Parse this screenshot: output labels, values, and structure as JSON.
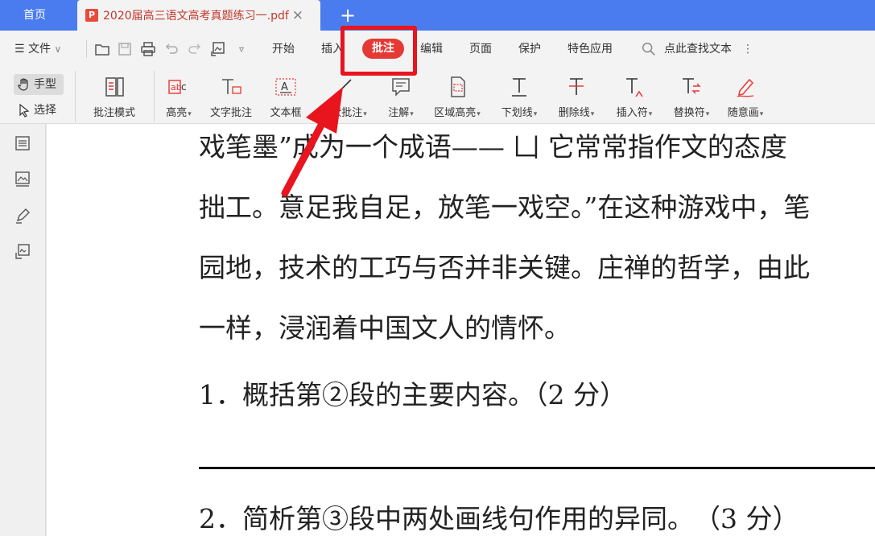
{
  "tabs": {
    "home": "首页",
    "doc_title": "2020届高三语文高考真题练习一.pdf",
    "doc_icon": "pdf-icon",
    "close_icon": "close-icon",
    "add_icon": "plus-icon"
  },
  "menu": {
    "hamburger_icon": "menu-icon",
    "file": "文件",
    "items": [
      "开始",
      "插入",
      "批注",
      "编辑",
      "页面",
      "保护",
      "特色应用"
    ],
    "active": "批注",
    "search_placeholder": "点此查找文本",
    "more_icon": "more-vertical-icon"
  },
  "ribbon": {
    "hand": "手型",
    "select": "选择",
    "tools": [
      "批注模式",
      "高亮",
      "文字批注",
      "文本框",
      "形状批注",
      "注解",
      "区域高亮",
      "下划线",
      "删除线",
      "插入符",
      "替换符",
      "随意画"
    ]
  },
  "document": {
    "lines": [
      "戏笔墨”成为一个成语—— 凵 它常常指作文的态度",
      "拙工。意足我自足，放笔一戏空。”在这种游戏中，笔",
      "园地，技术的工巧与否并非关键。庄禅的哲学，由此",
      "一样，浸润着中国文人的情怀。",
      "1．概括第②段的主要内容。（2 分）",
      "2．简析第③段中两处画线句作用的异同。　（3 分）"
    ]
  },
  "colors": {
    "tab_bar": "#4a7cf0",
    "accent_red": "#e53935",
    "highlight_box": "#e8141e"
  }
}
